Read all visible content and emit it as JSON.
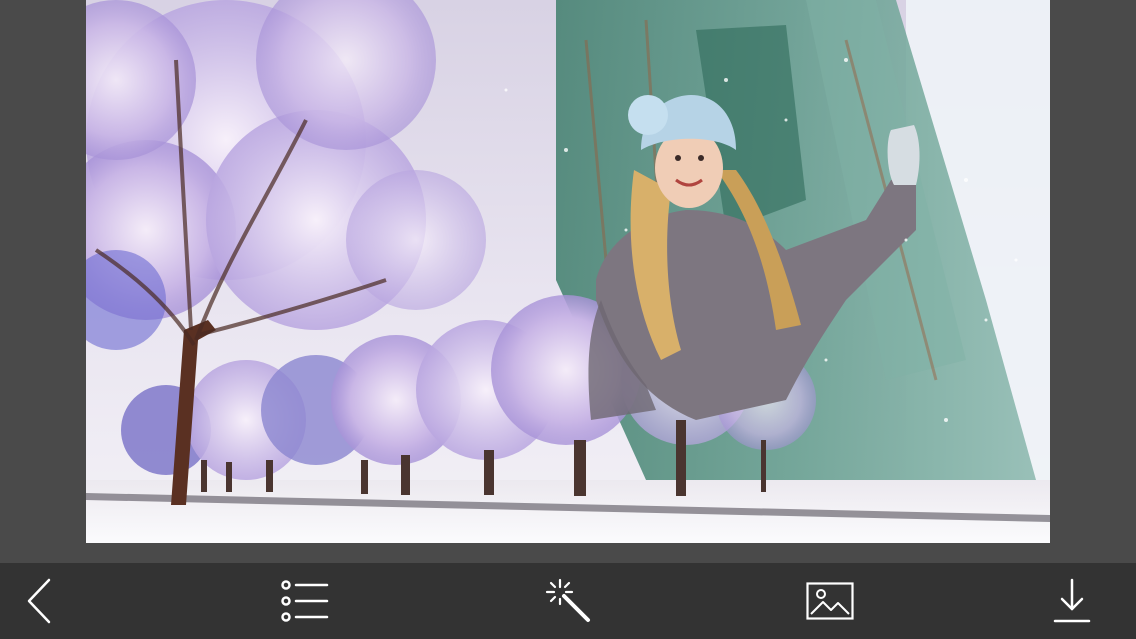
{
  "editor": {
    "photo": {
      "description_icon": "photo-preview-icon"
    }
  },
  "toolbar": {
    "background": "#333333",
    "icon_color": "#ffffff",
    "buttons": [
      {
        "icon": "back-chevron-icon"
      },
      {
        "icon": "list-icon"
      },
      {
        "icon": "magic-wand-icon"
      },
      {
        "icon": "image-icon"
      },
      {
        "icon": "download-icon"
      }
    ]
  }
}
